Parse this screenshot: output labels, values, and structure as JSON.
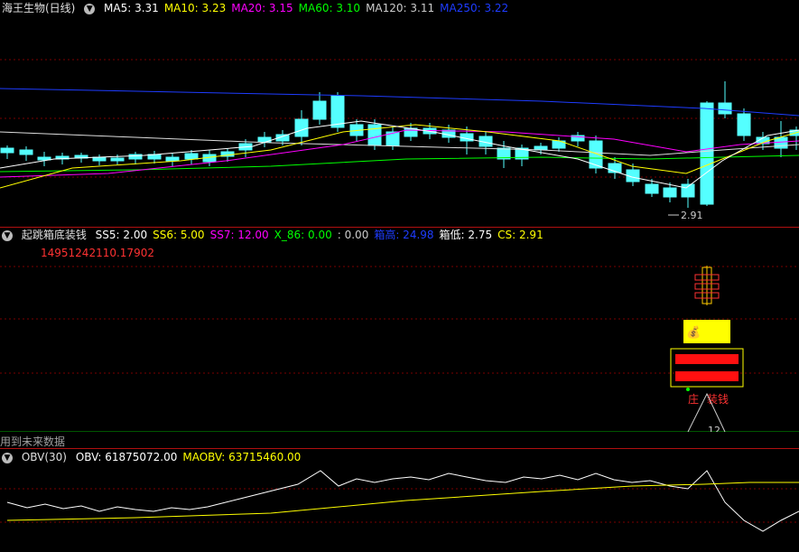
{
  "main": {
    "title": "海王生物(日线)",
    "ma": [
      {
        "label": "MA5: 3.31",
        "color": "#ffffff"
      },
      {
        "label": "MA10: 3.23",
        "color": "#ffff00"
      },
      {
        "label": "MA20: 3.15",
        "color": "#ff00ff"
      },
      {
        "label": "MA60: 3.10",
        "color": "#00ff00"
      },
      {
        "label": "MA120: 3.11",
        "color": "#cccccc"
      },
      {
        "label": "MA250: 3.22",
        "color": "#1e3cff"
      }
    ],
    "low_marker": "2.91"
  },
  "ind1": {
    "title": "起跳箱底装钱",
    "fields": [
      {
        "label": "SS5: 2.00",
        "color": "#ffffff"
      },
      {
        "label": "SS6: 5.00",
        "color": "#ffff00"
      },
      {
        "label": "SS7: 12.00",
        "color": "#ff00ff"
      },
      {
        "label": "X_86: 0.00",
        "color": "#00ff00"
      },
      {
        "label": ": 0.00",
        "color": "#cccccc"
      },
      {
        "label": "箱高: 24.98",
        "color": "#1e3cff"
      },
      {
        "label": "箱低: 2.75",
        "color": "#ffffff"
      },
      {
        "label": "CS: 2.91",
        "color": "#ffff00"
      }
    ],
    "value_line": "14951242110.17902",
    "signal_zhuang": "庄",
    "signal_zhuangqian": "装钱",
    "peak_label": "12",
    "footer": "用到未来数据"
  },
  "ind2": {
    "title": "OBV(30)",
    "fields": [
      {
        "label": "OBV: 61875072.00",
        "color": "#ffffff"
      },
      {
        "label": "MAOBV: 63715460.00",
        "color": "#ffff00"
      }
    ]
  },
  "colors": {
    "up": "#ff3232",
    "down": "#54ffff",
    "sep": "#b01010"
  }
}
